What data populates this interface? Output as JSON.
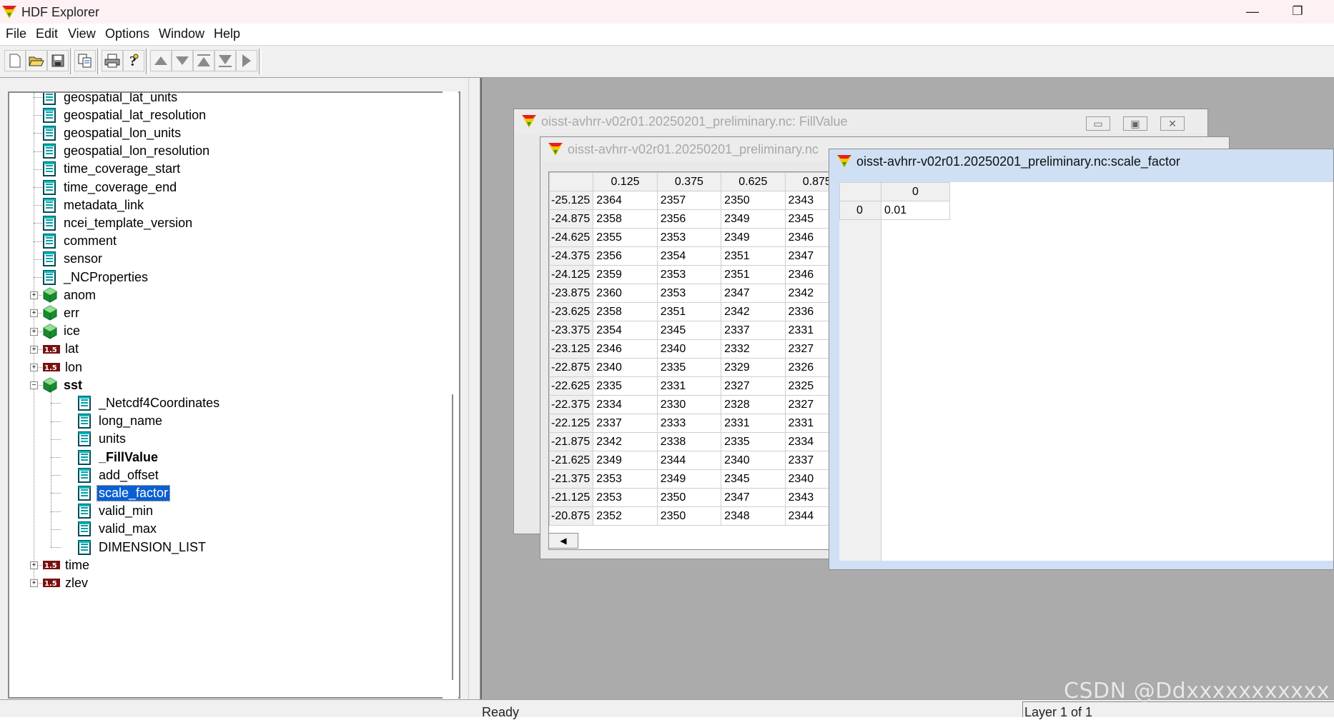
{
  "app": {
    "title": "HDF Explorer",
    "minimize_glyph": "—",
    "restore_glyph": "❐"
  },
  "menu": [
    "File",
    "Edit",
    "View",
    "Options",
    "Window",
    "Help"
  ],
  "toolbar": {
    "buttons": [
      "new-icon",
      "open-icon",
      "save-icon",
      "copy-icon",
      "print-icon",
      "help-icon",
      "arrow-up-icon",
      "arrow-down-icon",
      "arrow-top-icon",
      "arrow-bottom-icon",
      "arrow-right-icon"
    ]
  },
  "tree": {
    "items": [
      {
        "label": "geospatial_lat_units",
        "kind": "attr"
      },
      {
        "label": "geospatial_lat_resolution",
        "kind": "attr"
      },
      {
        "label": "geospatial_lon_units",
        "kind": "attr"
      },
      {
        "label": "geospatial_lon_resolution",
        "kind": "attr"
      },
      {
        "label": "time_coverage_start",
        "kind": "attr"
      },
      {
        "label": "time_coverage_end",
        "kind": "attr"
      },
      {
        "label": "metadata_link",
        "kind": "attr"
      },
      {
        "label": "ncei_template_version",
        "kind": "attr"
      },
      {
        "label": "comment",
        "kind": "attr"
      },
      {
        "label": "sensor",
        "kind": "attr"
      },
      {
        "label": "_NCProperties",
        "kind": "attr"
      },
      {
        "label": "anom",
        "kind": "dataset",
        "expander": "+"
      },
      {
        "label": "err",
        "kind": "dataset",
        "expander": "+"
      },
      {
        "label": "ice",
        "kind": "dataset",
        "expander": "+"
      },
      {
        "label": "lat",
        "kind": "numeric",
        "expander": "+"
      },
      {
        "label": "lon",
        "kind": "numeric",
        "expander": "+"
      },
      {
        "label": "sst",
        "kind": "dataset",
        "expander": "−",
        "bold": true
      },
      {
        "label": "_Netcdf4Coordinates",
        "kind": "attr",
        "child": true
      },
      {
        "label": "long_name",
        "kind": "attr",
        "child": true
      },
      {
        "label": "units",
        "kind": "attr",
        "child": true
      },
      {
        "label": "_FillValue",
        "kind": "attr",
        "child": true,
        "bold": true
      },
      {
        "label": "add_offset",
        "kind": "attr",
        "child": true
      },
      {
        "label": "scale_factor",
        "kind": "attr",
        "child": true,
        "selected": true
      },
      {
        "label": "valid_min",
        "kind": "attr",
        "child": true
      },
      {
        "label": "valid_max",
        "kind": "attr",
        "child": true
      },
      {
        "label": "DIMENSION_LIST",
        "kind": "attr",
        "child": true
      },
      {
        "label": "time",
        "kind": "numeric",
        "expander": "+"
      },
      {
        "label": "zlev",
        "kind": "numeric",
        "expander": "+"
      }
    ]
  },
  "windows": {
    "fillvalue": {
      "title": "oisst-avhrr-v02r01.20250201_preliminary.nc: FillValue"
    },
    "data": {
      "title": "oisst-avhrr-v02r01.20250201_preliminary.nc",
      "columns": [
        "0.125",
        "0.375",
        "0.625",
        "0.875"
      ],
      "rows": [
        {
          "h": "-25.125",
          "v": [
            "2364",
            "2357",
            "2350",
            "2343"
          ]
        },
        {
          "h": "-24.875",
          "v": [
            "2358",
            "2356",
            "2349",
            "2345"
          ]
        },
        {
          "h": "-24.625",
          "v": [
            "2355",
            "2353",
            "2349",
            "2346"
          ]
        },
        {
          "h": "-24.375",
          "v": [
            "2356",
            "2354",
            "2351",
            "2347"
          ]
        },
        {
          "h": "-24.125",
          "v": [
            "2359",
            "2353",
            "2351",
            "2346"
          ]
        },
        {
          "h": "-23.875",
          "v": [
            "2360",
            "2353",
            "2347",
            "2342"
          ]
        },
        {
          "h": "-23.625",
          "v": [
            "2358",
            "2351",
            "2342",
            "2336"
          ]
        },
        {
          "h": "-23.375",
          "v": [
            "2354",
            "2345",
            "2337",
            "2331"
          ]
        },
        {
          "h": "-23.125",
          "v": [
            "2346",
            "2340",
            "2332",
            "2327"
          ]
        },
        {
          "h": "-22.875",
          "v": [
            "2340",
            "2335",
            "2329",
            "2326"
          ]
        },
        {
          "h": "-22.625",
          "v": [
            "2335",
            "2331",
            "2327",
            "2325"
          ]
        },
        {
          "h": "-22.375",
          "v": [
            "2334",
            "2330",
            "2328",
            "2327"
          ]
        },
        {
          "h": "-22.125",
          "v": [
            "2337",
            "2333",
            "2331",
            "2331"
          ]
        },
        {
          "h": "-21.875",
          "v": [
            "2342",
            "2338",
            "2335",
            "2334"
          ]
        },
        {
          "h": "-21.625",
          "v": [
            "2349",
            "2344",
            "2340",
            "2337"
          ]
        },
        {
          "h": "-21.375",
          "v": [
            "2353",
            "2349",
            "2345",
            "2340"
          ]
        },
        {
          "h": "-21.125",
          "v": [
            "2353",
            "2350",
            "2347",
            "2343"
          ]
        },
        {
          "h": "-20.875",
          "v": [
            "2352",
            "2350",
            "2348",
            "2344"
          ]
        }
      ]
    },
    "scale": {
      "title": "oisst-avhrr-v02r01.20250201_preliminary.nc:scale_factor",
      "col_header": "0",
      "row_header": "0",
      "value": "0.01"
    }
  },
  "status": {
    "left": "Ready",
    "right": "Layer 1 of 1"
  },
  "watermark": "CSDN @Ddxxxxxxxxxxx"
}
